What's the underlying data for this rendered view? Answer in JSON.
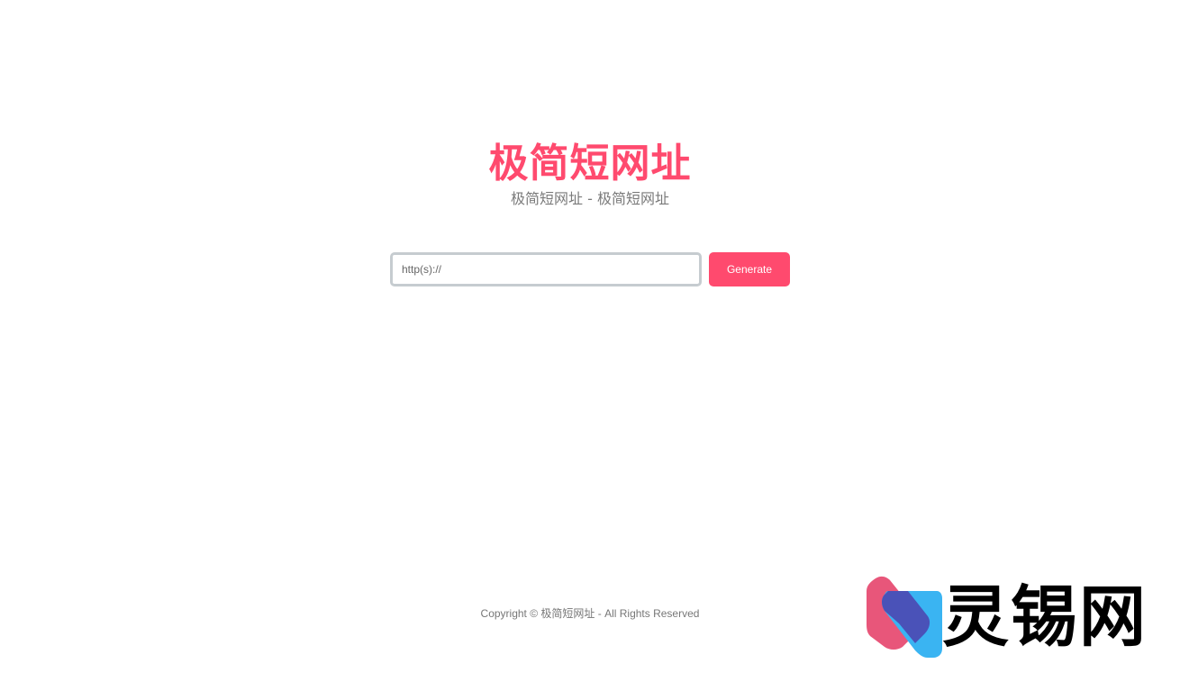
{
  "header": {
    "title": "极简短网址",
    "subtitle": "极简短网址 - 极简短网址"
  },
  "form": {
    "url_placeholder": "http(s)://",
    "url_value": "",
    "generate_label": "Generate"
  },
  "footer": {
    "copyright": "Copyright © 极简短网址 - All Rights Reserved"
  },
  "watermark": {
    "text": "灵锡网",
    "icon": "lingxi-logo-icon"
  },
  "colors": {
    "accent": "#ff4a6e",
    "subtitle_text": "#7a7a7a",
    "input_border": "#c6ccd0",
    "logo_pink": "#e8567a",
    "logo_blue": "#3ab4f2",
    "logo_overlap": "#4a52b8"
  }
}
